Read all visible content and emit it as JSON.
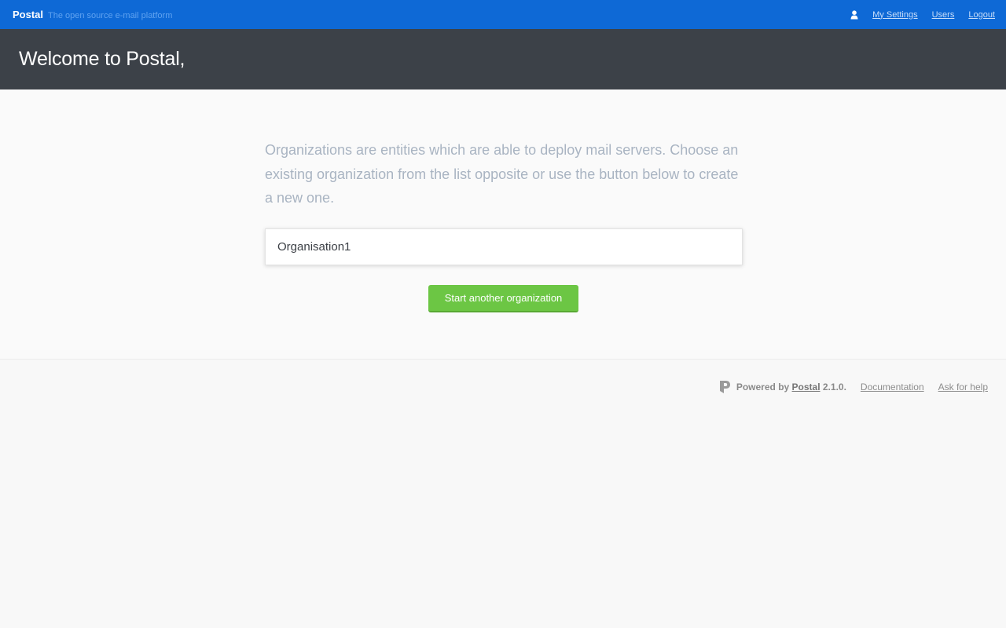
{
  "topbar": {
    "brand_name": "Postal",
    "tagline": "The open source e-mail platform",
    "links": {
      "my_settings": "My Settings",
      "users": "Users",
      "logout": "Logout"
    },
    "user_icon": "user-icon",
    "background": "#0e69d6"
  },
  "hero": {
    "title": "Welcome to Postal,",
    "background": "#3c4148"
  },
  "main": {
    "intro": "Organizations are entities which are able to deploy mail servers. Choose an existing organization from the list opposite or use the button below to create a new one.",
    "organizations": [
      {
        "name": "Organisation1"
      }
    ],
    "start_button": "Start another organization",
    "button_color": "#6cc644"
  },
  "footer": {
    "logo_icon": "postal-logo-icon",
    "powered_prefix": "Powered by ",
    "powered_link": "Postal",
    "version": " 2.1.0.",
    "documentation": "Documentation",
    "ask_for_help": "Ask for help"
  }
}
